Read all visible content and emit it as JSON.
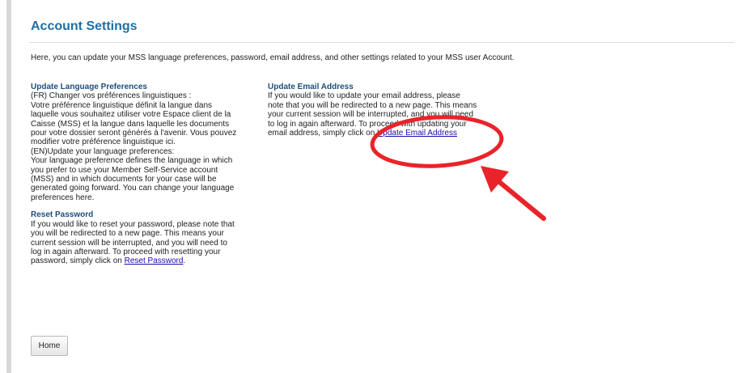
{
  "page": {
    "title": "Account Settings",
    "intro": "Here, you can update your MSS language preferences, password, email address, and other settings related to your MSS user Account."
  },
  "language": {
    "heading": "Update Language Preferences",
    "body": "(FR) Changer vos préférences linguistiques :\nVotre préférence linguistique définit la langue dans\nlaquelle vous souhaitez utiliser votre Espace client de la\nCaisse (MSS) et la langue dans laquelle les documents\npour votre dossier seront générés à l'avenir. Vous pouvez\nmodifier votre préférence linguistique ici.\n(EN)Update your language preferences:\nYour language preference defines the language in which\nyou prefer to use your Member Self-Service account\n(MSS) and in which documents for your case will be\ngenerated going forward. You can change your language\npreferences here."
  },
  "password": {
    "heading": "Reset Password",
    "body": "If you would like to reset your password, please note that\nyou will be redirected to a new page. This means your\ncurrent session will be interrupted, and you will need to\nlog in again afterward. To proceed with resetting your\npassword, simply click on ",
    "link": "Reset Password",
    "after": "."
  },
  "email": {
    "heading": "Update Email Address",
    "body": "If you would like to update your email address, please\nnote that you will be redirected to a new page. This means\nyour current session will be interrupted, and you will need\nto log in again afterward. To proceed with updating your\nemail address, simply click on ",
    "link": "Update Email Address"
  },
  "buttons": {
    "home": "Home"
  },
  "annotation": {
    "color": "#e8242a"
  }
}
